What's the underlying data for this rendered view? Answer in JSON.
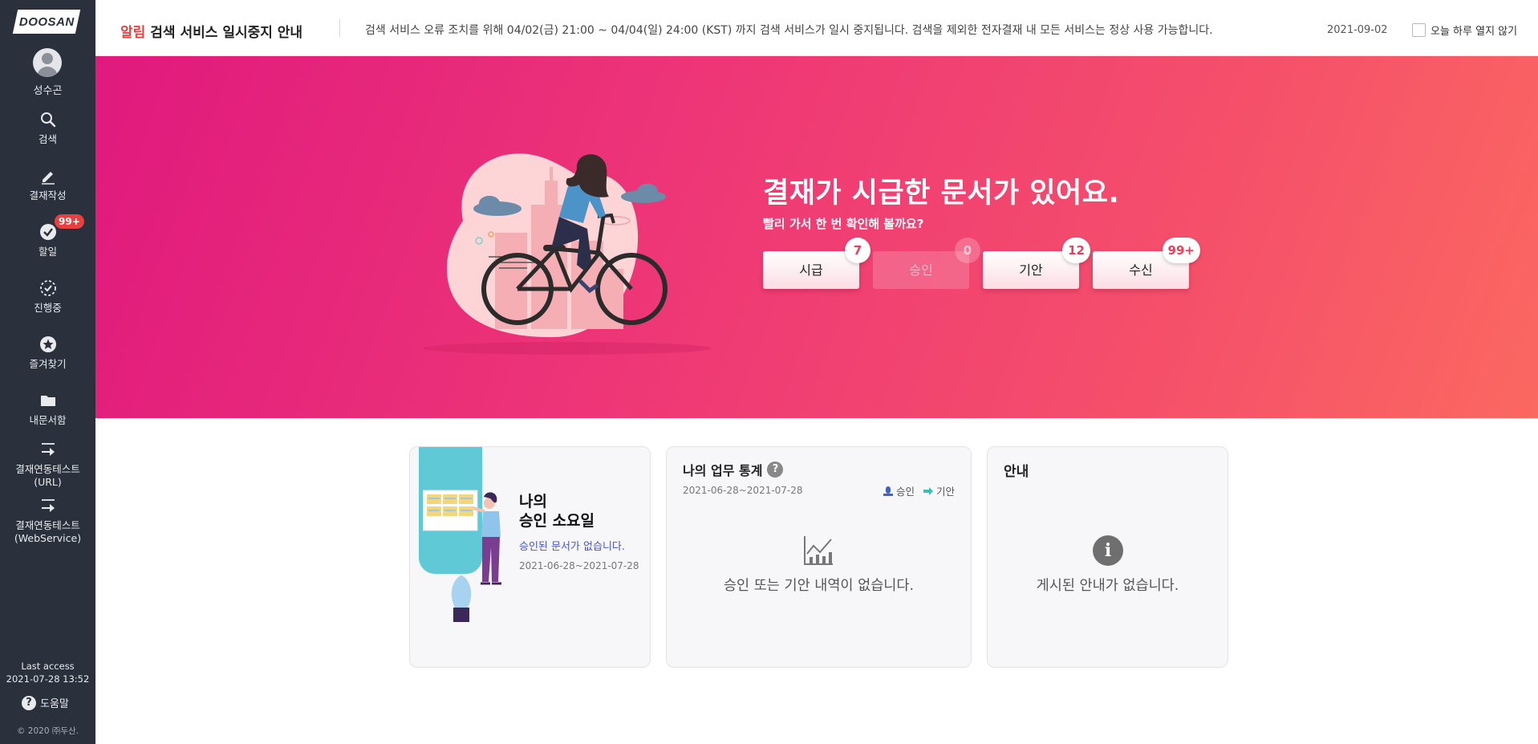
{
  "brand": {
    "logo_text": "DOOSAN"
  },
  "sidebar": {
    "user_name": "성수곤",
    "items": [
      {
        "label": "검색",
        "icon": "search-icon"
      },
      {
        "label": "결재작성",
        "icon": "pencil-icon"
      },
      {
        "label": "할일",
        "icon": "check-circle-icon",
        "badge": "99+"
      },
      {
        "label": "진행중",
        "icon": "progress-check-icon"
      },
      {
        "label": "즐겨찾기",
        "icon": "star-circle-icon"
      },
      {
        "label": "내문서함",
        "icon": "folder-icon"
      },
      {
        "label": "결재연동테스트",
        "label2": "(URL)",
        "icon": "arrow-right-icon"
      },
      {
        "label": "결재연동테스트",
        "label2": "(WebService)",
        "icon": "arrow-right-icon"
      }
    ],
    "last_access_label": "Last access",
    "last_access_value": "2021-07-28 13:52",
    "help_label": "도움말",
    "copyright": "© 2020 ㈜두산."
  },
  "notice": {
    "tag": "알림",
    "title": "검색 서비스 일시중지 안내",
    "text": "검색 서비스 오류 조치를 위해 04/02(금) 21:00 ~ 04/04(일) 24:00 (KST) 까지 검색 서비스가 일시 중지됩니다. 검색을 제외한 전자결재 내 모든 서비스는 정상 사용 가능합니다.",
    "date": "2021-09-02",
    "dismiss_label": "오늘 하루 열지 않기"
  },
  "hero": {
    "title": "결재가 시급한 문서가 있어요.",
    "subtitle": "빨리 가서 한 번 확인해 볼까요?",
    "buttons": [
      {
        "label": "시급",
        "count": "7",
        "enabled": true
      },
      {
        "label": "승인",
        "count": "0",
        "enabled": false
      },
      {
        "label": "기안",
        "count": "12",
        "enabled": true
      },
      {
        "label": "수신",
        "count": "99+",
        "enabled": true
      }
    ],
    "gradient_start": "#e0197e",
    "gradient_end": "#fb6860"
  },
  "cards": {
    "weekday": {
      "title_line1": "나의",
      "title_line2": "승인 소요일",
      "message": "승인된 문서가 없습니다.",
      "range": "2021-06-28~2021-07-28"
    },
    "stats": {
      "title": "나의 업무 통계",
      "help_icon": "question-icon",
      "range": "2021-06-28~2021-07-28",
      "legend_approve": "승인",
      "legend_draft": "기안",
      "empty": "승인 또는 기안 내역이 없습니다."
    },
    "info": {
      "title": "안내",
      "empty": "게시된 안내가 없습니다."
    }
  }
}
